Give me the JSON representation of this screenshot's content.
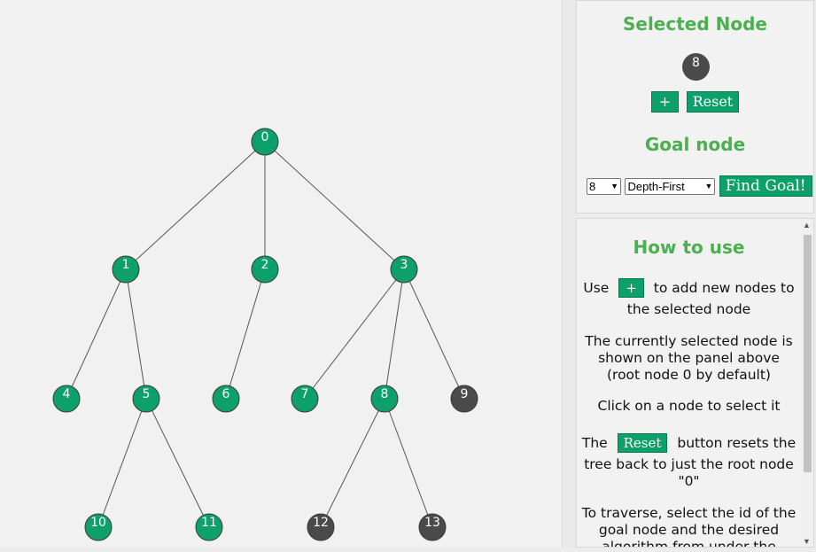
{
  "tree": {
    "nodes": [
      {
        "id": "0",
        "color": "#0ea06b"
      },
      {
        "id": "1",
        "color": "#0ea06b"
      },
      {
        "id": "2",
        "color": "#0ea06b"
      },
      {
        "id": "3",
        "color": "#0ea06b"
      },
      {
        "id": "4",
        "color": "#0ea06b"
      },
      {
        "id": "5",
        "color": "#0ea06b"
      },
      {
        "id": "6",
        "color": "#0ea06b"
      },
      {
        "id": "7",
        "color": "#0ea06b"
      },
      {
        "id": "8",
        "color": "#0ea06b"
      },
      {
        "id": "9",
        "color": "#4a4a4a"
      },
      {
        "id": "10",
        "color": "#0ea06b"
      },
      {
        "id": "11",
        "color": "#0ea06b"
      },
      {
        "id": "12",
        "color": "#4a4a4a"
      },
      {
        "id": "13",
        "color": "#4a4a4a"
      }
    ],
    "edges": [
      [
        "0",
        "1"
      ],
      [
        "0",
        "2"
      ],
      [
        "0",
        "3"
      ],
      [
        "1",
        "4"
      ],
      [
        "1",
        "5"
      ],
      [
        "2",
        "6"
      ],
      [
        "3",
        "7"
      ],
      [
        "3",
        "8"
      ],
      [
        "3",
        "9"
      ],
      [
        "5",
        "10"
      ],
      [
        "5",
        "11"
      ],
      [
        "8",
        "12"
      ],
      [
        "8",
        "13"
      ]
    ]
  },
  "selected_panel": {
    "title": "Selected Node",
    "selected_node": "8",
    "add_label": "+",
    "reset_label": "Reset"
  },
  "goal_panel": {
    "title": "Goal node",
    "goal_value": "8",
    "algorithm_value": "Depth-First",
    "find_label": "Find Goal!"
  },
  "help": {
    "title": "How to use",
    "use_before": "Use",
    "add_label": "+",
    "use_after": "to add new nodes to",
    "use_line2": "the selected node",
    "selected_info": "The currently selected node is shown on the panel above (root node 0 by default)",
    "click_info": "Click on a node to select it",
    "reset_before": "The",
    "reset_label": "Reset",
    "reset_after": "button resets the",
    "reset_line2": "tree back to just the root node \"0\"",
    "traverse_info": "To traverse, select the id of the goal node and the desired algorithm from under the"
  },
  "colors": {
    "green": "#0ea06b",
    "dark": "#4a4a4a",
    "accent": "#4caf50"
  }
}
